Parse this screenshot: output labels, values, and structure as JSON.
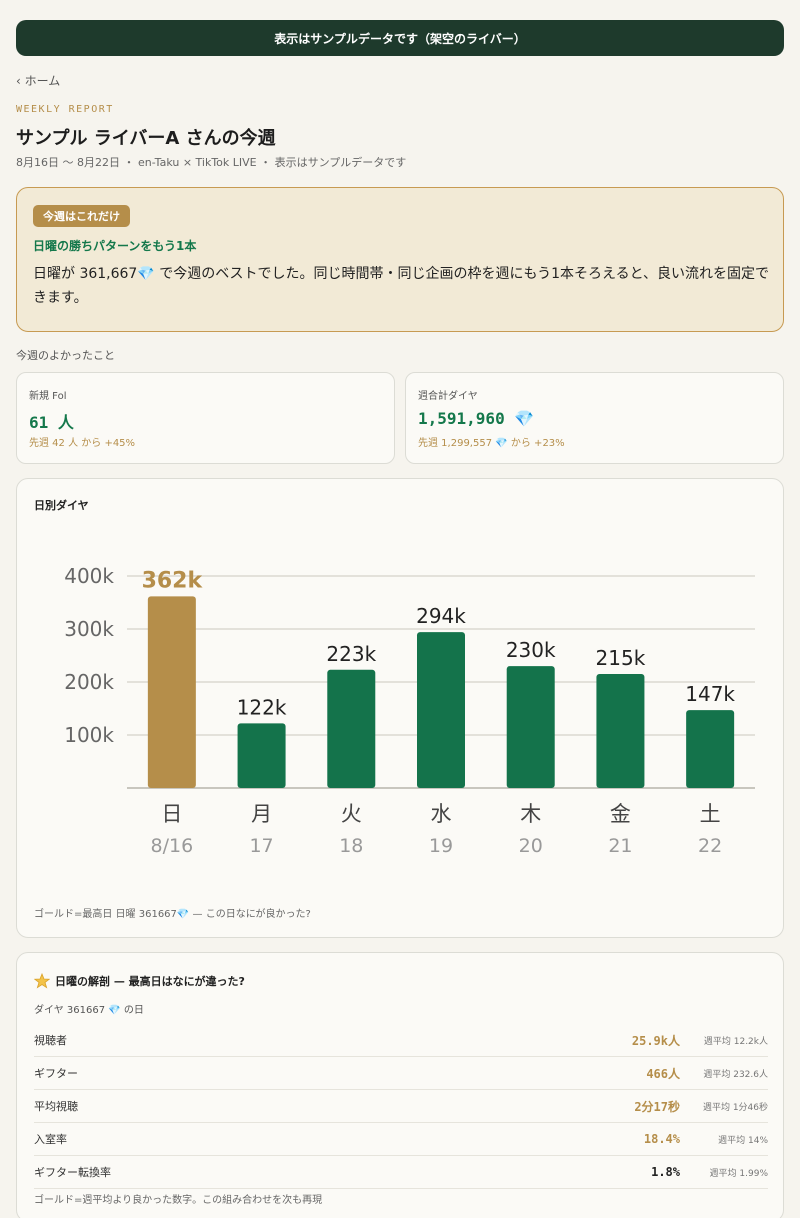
{
  "banner": "表示はサンプルデータです（架空のライバー）",
  "nav": {
    "back": "‹ ホーム"
  },
  "header": {
    "eyebrow": "WEEKLY REPORT",
    "title": "サンプル ライバーA さんの今週",
    "subtitle": "8月16日 〜 8月22日 ・ en-Taku × TikTok LIVE ・ 表示はサンプルデータです"
  },
  "callout": {
    "badge": "今週はこれだけ",
    "headline": "日曜の勝ちパターンをもう1本",
    "body": "日曜が 361,667💎 で今週のベストでした。同じ時間帯・同じ企画の枠を週にもう1本そろえると、良い流れを固定できます。"
  },
  "good_section": "今週のよかったこと",
  "stats": [
    {
      "label": "新規 Fol",
      "value": "61 人",
      "delta": "先週 42 人 から +45%"
    },
    {
      "label": "週合計ダイヤ",
      "value": "1,591,960 💎",
      "delta": "先週 1,299,557 💎 から +23%"
    }
  ],
  "chart_card": {
    "title": "日別ダイヤ",
    "note": "ゴールド=最高日 日曜 361667💎 — この日なにが良かった?"
  },
  "chart_data": {
    "type": "bar",
    "categories": [
      "日",
      "月",
      "火",
      "水",
      "木",
      "金",
      "土"
    ],
    "dates": [
      "8/16",
      "17",
      "18",
      "19",
      "20",
      "21",
      "22"
    ],
    "values": [
      361667,
      122000,
      223000,
      294000,
      230000,
      215000,
      147000
    ],
    "value_labels": [
      "362k",
      "122k",
      "223k",
      "294k",
      "230k",
      "215k",
      "147k"
    ],
    "yticks": [
      100000,
      200000,
      300000,
      400000
    ],
    "ytick_labels": [
      "100k",
      "200k",
      "300k",
      "400k"
    ],
    "ylim": [
      0,
      400000
    ],
    "highlight_index": 0,
    "colors": {
      "bar": "#14734b",
      "highlight": "#b58e4a",
      "grid": "#e3e1da",
      "axis": "#c8c6be"
    }
  },
  "best_day": {
    "title": "日曜の解剖 — 最高日はなにが違った?",
    "icon": "star-icon",
    "subtitle": "ダイヤ 361667 💎 の日",
    "metrics": [
      {
        "label": "視聴者",
        "value": "25.9k人",
        "avg": "週平均 12.2k人",
        "highlight": true
      },
      {
        "label": "ギフター",
        "value": "466人",
        "avg": "週平均 232.6人",
        "highlight": true
      },
      {
        "label": "平均視聴",
        "value": "2分17秒",
        "avg": "週平均 1分46秒",
        "highlight": true
      },
      {
        "label": "入室率",
        "value": "18.4%",
        "avg": "週平均 14%",
        "highlight": true
      },
      {
        "label": "ギフター転換率",
        "value": "1.8%",
        "avg": "週平均 1.99%",
        "highlight": false
      }
    ],
    "note": "ゴールド=週平均より良かった数字。この組み合わせを次も再現"
  }
}
